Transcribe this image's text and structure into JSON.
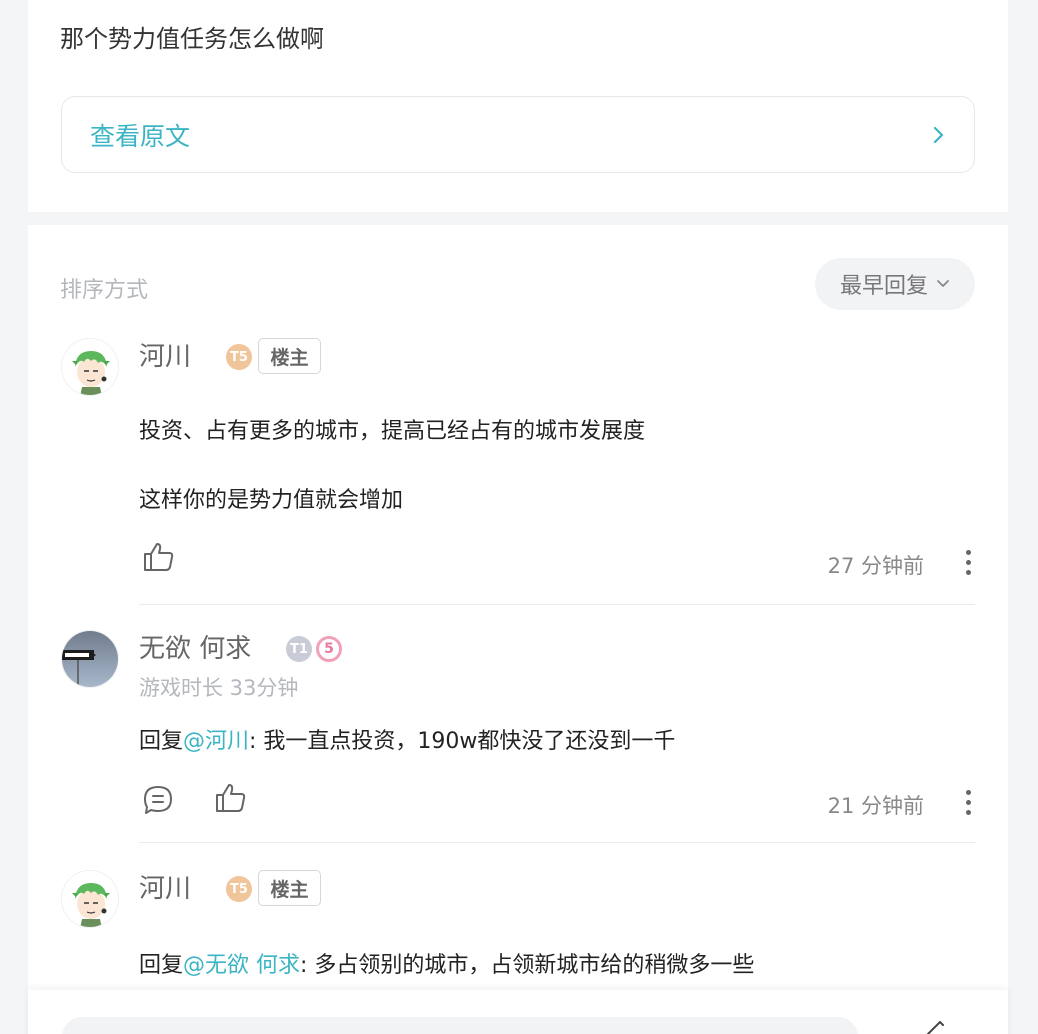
{
  "post": {
    "text": "那个势力值任务怎么做啊",
    "view_original": "查看原文"
  },
  "sort": {
    "label": "排序方式",
    "selected": "最早回复"
  },
  "comments": [
    {
      "username": "河川",
      "level_badge": "T5",
      "owner_badge": "楼主",
      "body_line1": "投资、占有更多的城市，提高已经占有的城市发展度",
      "body_line2": "这样你的是势力值就会增加",
      "time": "27 分钟前"
    },
    {
      "username": "无欲 何求",
      "level_badge": "T1",
      "extra_badge": "5",
      "playtime": "游戏时长 33分钟",
      "reply_prefix": "回复",
      "reply_mention": "@河川",
      "reply_text": ": 我一直点投资，190w都快没了还没到一千",
      "time": "21 分钟前"
    },
    {
      "username": "河川",
      "level_badge": "T5",
      "owner_badge": "楼主",
      "reply_prefix": "回复",
      "reply_mention": "@无欲 何求",
      "reply_text": ": 多占领别的城市，占领新城市给的稍微多一些"
    }
  ],
  "colors": {
    "accent": "#3bb4c4",
    "background": "#f4f5f7",
    "badge_gold": "#f0c59a"
  }
}
